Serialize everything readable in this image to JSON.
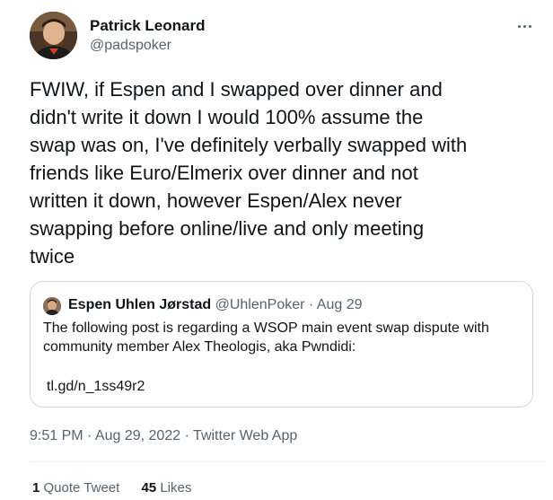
{
  "tweet": {
    "author": {
      "display_name": "Patrick Leonard",
      "handle": "@padspoker"
    },
    "more_icon": "more-horizontal-icon",
    "text_lines": [
      "FWIW, if Espen and I swapped over dinner and",
      "didn't write it down I would 100% assume the",
      "swap was on, I've definitely verbally swapped with",
      "friends like Euro/Elmerix over dinner and not",
      "written it down, however Espen/Alex never",
      "swapping before online/live and only meeting",
      "twice"
    ],
    "quoted": {
      "display_name": "Espen Uhlen Jørstad",
      "meta": "@UhlenPoker · Aug 29",
      "text_lines": [
        "The following post is regarding a WSOP main event swap dispute with",
        "community member Alex Theologis, aka Pwndidi:"
      ],
      "link": "tl.gd/n_1ss49r2"
    },
    "timestamp": "9:51 PM · Aug 29, 2022 · Twitter Web App",
    "stats": {
      "quote_count": "1",
      "quote_label": "Quote Tweet",
      "like_count": "45",
      "like_label": "Likes"
    }
  },
  "colors": {
    "text_primary": "#0f1419",
    "text_secondary": "#536471",
    "border": "#cfd9de"
  }
}
